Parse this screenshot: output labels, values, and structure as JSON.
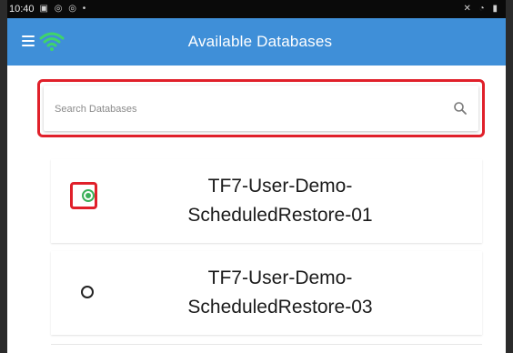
{
  "status_bar": {
    "time": "10:40",
    "left_icons": "▣ ◎ ◎ •",
    "right_icons": "✕ ◔ ▮"
  },
  "app_bar": {
    "title": "Available Databases",
    "menu_icon": "hamburger-icon",
    "status_icon": "wifi-icon",
    "colors": {
      "background": "#3f8fd8",
      "wifi": "#3fd46a"
    }
  },
  "search": {
    "placeholder": "Search Databases",
    "value": "",
    "icon": "search-icon"
  },
  "databases": [
    {
      "name_line1": "TF7-User-Demo-",
      "name_line2": "ScheduledRestore-01",
      "selected": true
    },
    {
      "name_line1": "TF7-User-Demo-",
      "name_line2": "ScheduledRestore-03",
      "selected": false
    }
  ],
  "colors": {
    "highlight": "#e0202a",
    "radio_selected": "#3cb05a"
  }
}
